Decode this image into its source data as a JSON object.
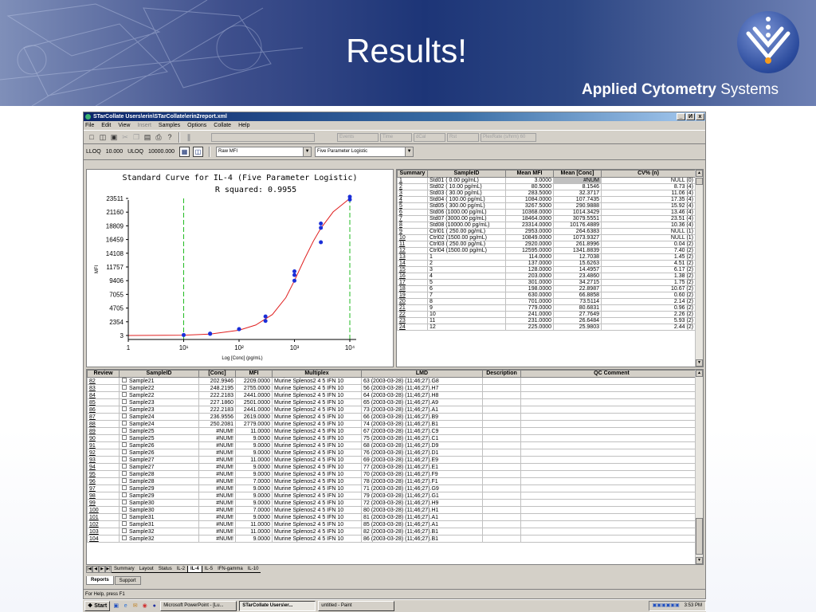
{
  "slide": {
    "title": "Results!",
    "logo_bold": "Applied Cytometry",
    "logo_thin": "Systems"
  },
  "window": {
    "title": "STarCollate  Users\\erin\\STarCollate\\erin2report.xml",
    "controls": [
      "_",
      "И",
      "x"
    ],
    "menu": [
      "File",
      "Edit",
      "View",
      "Insert",
      "Samples",
      "Options",
      "Collate",
      "Help"
    ]
  },
  "toolbar": {
    "icons": [
      "new-icon",
      "open-icon",
      "save-icon",
      "cut-icon",
      "copy-icon",
      "paste-icon",
      "print-icon",
      "help-icon"
    ],
    "fields": [
      "Events",
      "Time",
      "dCal",
      "Rst",
      "PlexRate (s/hrm)  60"
    ]
  },
  "limits": {
    "lloq_label": "LLOQ",
    "lloq_value": "10.000",
    "uloq_label": "ULOQ",
    "uloq_value": "10000.000",
    "data_select": "Raw MFI",
    "fit_select": "Five Parameter Logistic"
  },
  "chart_data": {
    "type": "scatter",
    "title": "Standard Curve for IL-4 (Five Parameter Logistic)",
    "subtitle": "R squared: 0.9955",
    "xlabel": "Log [Conc] (pg/mL)",
    "ylabel": "MFI",
    "x_scale": "log",
    "xlim": [
      1,
      10000
    ],
    "x_ticks": [
      "1",
      "10¹",
      "10²",
      "10³",
      "10⁴"
    ],
    "y_ticks": [
      "3",
      "2354",
      "4705",
      "7055",
      "9406",
      "11757",
      "14108",
      "16459",
      "18809",
      "21160",
      "23511"
    ],
    "ylim": [
      3,
      23511
    ],
    "limit_lines_x": [
      10,
      10000
    ],
    "points": [
      {
        "x": 10,
        "y": 80
      },
      {
        "x": 30,
        "y": 283
      },
      {
        "x": 30,
        "y": 320
      },
      {
        "x": 100,
        "y": 1084
      },
      {
        "x": 100,
        "y": 1100
      },
      {
        "x": 300,
        "y": 3267
      },
      {
        "x": 300,
        "y": 2500
      },
      {
        "x": 1000,
        "y": 10368
      },
      {
        "x": 1000,
        "y": 9406
      },
      {
        "x": 1000,
        "y": 11000
      },
      {
        "x": 3000,
        "y": 18464
      },
      {
        "x": 3000,
        "y": 19200
      },
      {
        "x": 3000,
        "y": 16000
      },
      {
        "x": 10000,
        "y": 23314
      },
      {
        "x": 10000,
        "y": 23800
      }
    ],
    "curve": [
      {
        "x": 1,
        "y": 3
      },
      {
        "x": 10,
        "y": 60
      },
      {
        "x": 30,
        "y": 250
      },
      {
        "x": 100,
        "y": 900
      },
      {
        "x": 200,
        "y": 1800
      },
      {
        "x": 400,
        "y": 3600
      },
      {
        "x": 700,
        "y": 6500
      },
      {
        "x": 1000,
        "y": 9400
      },
      {
        "x": 1500,
        "y": 13000
      },
      {
        "x": 2200,
        "y": 16200
      },
      {
        "x": 3000,
        "y": 18400
      },
      {
        "x": 5000,
        "y": 21200
      },
      {
        "x": 10000,
        "y": 23511
      }
    ]
  },
  "summary": {
    "headers": [
      "Summary",
      "SampleID",
      "Mean MFI",
      "Mean [Conc]",
      "CV% (n)"
    ],
    "rows": [
      [
        "1",
        "Std01 (   0.00 pg/mL)",
        "3.0000",
        "#NUM",
        "NULL (0)"
      ],
      [
        "2",
        "Std02 (  10.00 pg/mL)",
        "80.5000",
        "8.1546",
        "8.73 (4)"
      ],
      [
        "3",
        "Std03 (  30.00 pg/mL)",
        "283.5000",
        "32.3717",
        "11.06 (4)"
      ],
      [
        "4",
        "Std04 ( 100.00 pg/mL)",
        "1084.0000",
        "107.7435",
        "17.35 (4)"
      ],
      [
        "5",
        "Std05 ( 300.00 pg/mL)",
        "3267.5000",
        "290.9888",
        "15.92 (4)"
      ],
      [
        "6",
        "Std06 (1000.00 pg/mL)",
        "10368.0000",
        "1014.3429",
        "13.46 (4)"
      ],
      [
        "7",
        "Std07 (3000.00 pg/mL)",
        "18464.0000",
        "3079.5551",
        "23.51 (4)"
      ],
      [
        "8",
        "Std08 (10000.00 pg/mL)",
        "23314.0000",
        "10176.4889",
        "10.36 (4)"
      ],
      [
        "9",
        "Ctrl01 ( 250.00 pg/mL)",
        "2953.0000",
        "264.6383",
        "NULL (1)"
      ],
      [
        "10",
        "Ctrl02 (1500.00 pg/mL)",
        "10849.0000",
        "1073.9327",
        "NULL (1)"
      ],
      [
        "11",
        "Ctrl03 ( 250.00 pg/mL)",
        "2920.0000",
        "261.8996",
        "0.04 (2)"
      ],
      [
        "12",
        "Ctrl04 (1500.00 pg/mL)",
        "12595.0000",
        "1341.8839",
        "7.40 (2)"
      ],
      [
        "13",
        "1",
        "114.0000",
        "12.7038",
        "1.45 (2)"
      ],
      [
        "14",
        "2",
        "137.0000",
        "15.6263",
        "4.51 (2)"
      ],
      [
        "15",
        "3",
        "128.0000",
        "14.4957",
        "6.17 (2)"
      ],
      [
        "16",
        "4",
        "203.0000",
        "23.4860",
        "1.38 (2)"
      ],
      [
        "17",
        "5",
        "301.0000",
        "34.2715",
        "1.75 (2)"
      ],
      [
        "18",
        "6",
        "198.0000",
        "22.8987",
        "10.67 (2)"
      ],
      [
        "19",
        "7",
        "630.0000",
        "66.8858",
        "0.60 (2)"
      ],
      [
        "20",
        "8",
        "701.0000",
        "73.5114",
        "2.14 (2)"
      ],
      [
        "21",
        "9",
        "779.0000",
        "80.6831",
        "0.96 (2)"
      ],
      [
        "22",
        "10",
        "241.0000",
        "27.7649",
        "2.26 (2)"
      ],
      [
        "23",
        "11",
        "231.0000",
        "26.6484",
        "5.93 (2)"
      ],
      [
        "24",
        "12",
        "225.0000",
        "25.9803",
        "2.44 (2)"
      ]
    ]
  },
  "review": {
    "headers": [
      "Review",
      "SampleID",
      "[Conc]",
      "MFI",
      "Multiplex",
      "LMD",
      "Description",
      "QC Comment"
    ],
    "rows": [
      [
        "82",
        "Sample21",
        "202.9946",
        "2209.0000",
        "Murine Splenos2 4 5 IFN 10",
        "63 (2003-03-28) (11;46;27).G8"
      ],
      [
        "83",
        "Sample22",
        "248.2195",
        "2755.0000",
        "Murine Splenos2 4 5 IFN 10",
        "56 (2003-03-28) (11;46;27).H7"
      ],
      [
        "84",
        "Sample22",
        "222.2183",
        "2441.0000",
        "Murine Splenos2 4 5 IFN 10",
        "64 (2003-03-28) (11;46;27).H8"
      ],
      [
        "85",
        "Sample23",
        "227.1860",
        "2501.0000",
        "Murine Splenos2 4 5 IFN 10",
        "65 (2003-03-28) (11;46;27).A9"
      ],
      [
        "86",
        "Sample23",
        "222.2183",
        "2441.0000",
        "Murine Splenos2 4 5 IFN 10",
        "73 (2003-03-28) (11;46;27).A1"
      ],
      [
        "87",
        "Sample24",
        "236.9556",
        "2619.0000",
        "Murine Splenos2 4 5 IFN 10",
        "66 (2003-03-28) (11;46;27).B9"
      ],
      [
        "88",
        "Sample24",
        "250.2081",
        "2779.0000",
        "Murine Splenos2 4 5 IFN 10",
        "74 (2003-03-28) (11;46;27).B1"
      ],
      [
        "89",
        "Sample25",
        "#NUM!",
        "11.0000",
        "Murine Splenos2 4 5 IFN 10",
        "67 (2003-03-28) (11;46;27).C9"
      ],
      [
        "90",
        "Sample25",
        "#NUM!",
        "9.0000",
        "Murine Splenos2 4 5 IFN 10",
        "75 (2003-03-28) (11;46;27).C1"
      ],
      [
        "91",
        "Sample26",
        "#NUM!",
        "9.0000",
        "Murine Splenos2 4 5 IFN 10",
        "68 (2003-03-28) (11;46;27).D9"
      ],
      [
        "92",
        "Sample26",
        "#NUM!",
        "9.0000",
        "Murine Splenos2 4 5 IFN 10",
        "76 (2003-03-28) (11;46;27).D1"
      ],
      [
        "93",
        "Sample27",
        "#NUM!",
        "11.0000",
        "Murine Splenos2 4 5 IFN 10",
        "69 (2003-03-28) (11;46;27).E9"
      ],
      [
        "94",
        "Sample27",
        "#NUM!",
        "9.0000",
        "Murine Splenos2 4 5 IFN 10",
        "77 (2003-03-28) (11;46;27).E1"
      ],
      [
        "95",
        "Sample28",
        "#NUM!",
        "9.0000",
        "Murine Splenos2 4 5 IFN 10",
        "70 (2003-03-28) (11;46;27).F9"
      ],
      [
        "96",
        "Sample28",
        "#NUM!",
        "7.0000",
        "Murine Splenos2 4 5 IFN 10",
        "78 (2003-03-28) (11;46;27).F1"
      ],
      [
        "97",
        "Sample29",
        "#NUM!",
        "9.0000",
        "Murine Splenos2 4 5 IFN 10",
        "71 (2003-03-28) (11;46;27).G9"
      ],
      [
        "98",
        "Sample29",
        "#NUM!",
        "9.0000",
        "Murine Splenos2 4 5 IFN 10",
        "79 (2003-03-28) (11;46;27).G1"
      ],
      [
        "99",
        "Sample30",
        "#NUM!",
        "9.0000",
        "Murine Splenos2 4 5 IFN 10",
        "72 (2003-03-28) (11;46;27).H9"
      ],
      [
        "100",
        "Sample30",
        "#NUM!",
        "7.0000",
        "Murine Splenos2 4 5 IFN 10",
        "80 (2003-03-28) (11;46;27).H1"
      ],
      [
        "101",
        "Sample31",
        "#NUM!",
        "9.0000",
        "Murine Splenos2 4 5 IFN 10",
        "81 (2003-03-28) (11;46;27).A1"
      ],
      [
        "102",
        "Sample31",
        "#NUM!",
        "11.0000",
        "Murine Splenos2 4 5 IFN 10",
        "85 (2003-03-28) (11;46;27).A1"
      ],
      [
        "103",
        "Sample32",
        "#NUM!",
        "11.0000",
        "Murine Splenos2 4 5 IFN 10",
        "82 (2003-03-28) (11;46;27).B1"
      ],
      [
        "104",
        "Sample32",
        "#NUM!",
        "9.0000",
        "Murine Splenos2 4 5 IFN 10",
        "86 (2003-03-28) (11;46;27).B1"
      ]
    ]
  },
  "sheet_tabs": [
    "Summary",
    "Layout",
    "Status",
    "IL-2",
    "IL-4",
    "IL-5",
    "IFN-gamma",
    "IL-10"
  ],
  "active_sheet": "IL-4",
  "bottom_tabs": [
    "Reports",
    "Support"
  ],
  "status": "For Help, press F1",
  "taskbar": {
    "start": "Start",
    "buttons": [
      "Microsoft PowerPoint - [Lu...",
      "STarCollate  Users\\er...",
      "untitled - Paint"
    ],
    "clock": "3:53 PM"
  },
  "colors": {
    "title_bar": "#0a246a",
    "curve": "#e02020",
    "points": "#1b2fd8",
    "limit_lines": "#22bb22",
    "banner": "#1d3577"
  }
}
